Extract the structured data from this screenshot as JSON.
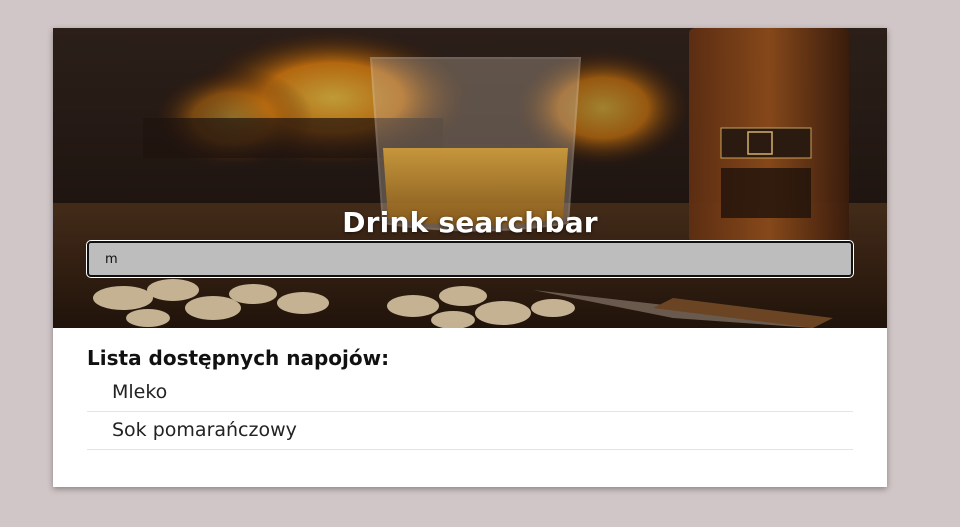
{
  "hero": {
    "title": "Drink searchbar"
  },
  "search": {
    "value": "m",
    "placeholder": ""
  },
  "drinks": {
    "heading": "Lista dostępnych napojów:",
    "items": [
      {
        "label": "Mleko"
      },
      {
        "label": "Sok pomarańczowy"
      }
    ]
  }
}
